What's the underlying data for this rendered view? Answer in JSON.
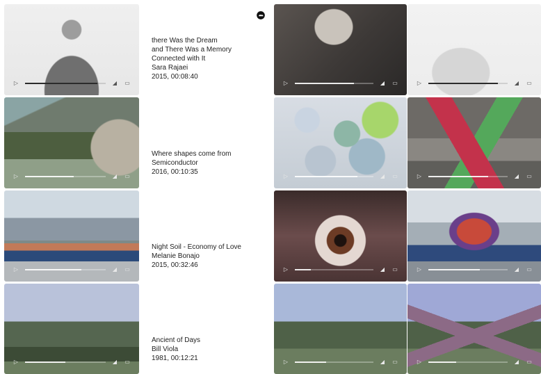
{
  "corner_icon": "cloud-icon",
  "rows": [
    {
      "caption": {
        "title_lines": [
          "there Was the Dream",
          "and There Was a Memory",
          "Connected with It"
        ],
        "artist": "Sara Rajaei",
        "meta": "2015, 00:08:40"
      },
      "tiles": [
        {
          "art": "figure",
          "theme": "light",
          "progress": 0.9
        },
        {
          "art": "horn",
          "theme": "dark",
          "progress": 0.75
        },
        {
          "art": "blank",
          "theme": "light",
          "progress": 0.88
        }
      ]
    },
    {
      "caption": {
        "title_lines": [
          "Where shapes come from"
        ],
        "artist": "Semiconductor",
        "meta": "2016, 00:10:35"
      },
      "tiles": [
        {
          "art": "factory",
          "theme": "dark",
          "progress": 0.6
        },
        {
          "art": "bubbles",
          "theme": "dark",
          "progress": 0.8
        },
        {
          "art": "pyramid",
          "theme": "dark",
          "progress": 0.75
        }
      ]
    },
    {
      "caption": {
        "title_lines": [
          "Night Soil - Economy of Love"
        ],
        "artist": "Melanie Bonajo",
        "meta": "2015, 00:32:46"
      },
      "tiles": [
        {
          "art": "bridge",
          "theme": "dark",
          "progress": 0.7
        },
        {
          "art": "eye",
          "theme": "dark",
          "progress": 0.2
        },
        {
          "art": "pile",
          "theme": "dark",
          "progress": 0.65
        }
      ]
    },
    {
      "caption": {
        "title_lines": [
          "Ancient of Days"
        ],
        "artist": "Bill Viola",
        "meta": "1981, 00:12:21"
      },
      "tiles": [
        {
          "art": "field-a",
          "theme": "dark",
          "progress": 0.5
        },
        {
          "art": "field-b",
          "theme": "dark",
          "progress": 0.4
        },
        {
          "art": "mountain",
          "theme": "dark",
          "progress": 0.35
        }
      ]
    }
  ],
  "controls": {
    "play_icon": "play-icon",
    "volume_icon": "volume-icon",
    "fullscreen_icon": "fullscreen-icon"
  }
}
